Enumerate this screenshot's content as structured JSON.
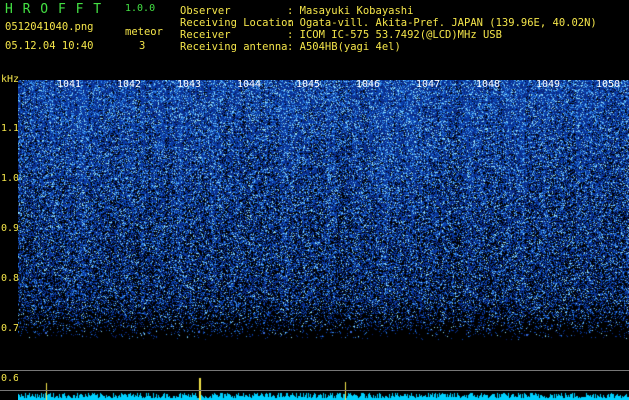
{
  "app": {
    "name": "H R O F F T",
    "version": "1.0.0",
    "filename": "0512041040.png",
    "datetime": "05.12.04 10:40",
    "meteor_label": "meteor",
    "meteor_count": "3"
  },
  "info": [
    {
      "label": "Observer",
      "value": ": Masayuki Kobayashi"
    },
    {
      "label": "Receiving Location",
      "value": ": Ogata-vill. Akita-Pref. JAPAN (139.96E, 40.02N)"
    },
    {
      "label": "Receiver",
      "value": ": ICOM IC-575 53.7492(@LCD)MHz USB"
    },
    {
      "label": "Receiving antenna",
      "value": ": A504HB(yagi 4el)"
    }
  ],
  "chart_data": {
    "type": "heatmap",
    "ylabel": "kHz",
    "y_ticks": [
      "1.1",
      "1.0",
      "0.9",
      "0.8",
      "0.7",
      "0.6"
    ],
    "x_ticks": [
      "1041",
      "1042",
      "1043",
      "1044",
      "1045",
      "1046",
      "1047",
      "1048",
      "1049",
      "1050"
    ],
    "colors": {
      "background": "#000000",
      "low": "#0a1a8a",
      "high": "#9fe8ff",
      "trace": "#00d0ff"
    }
  }
}
